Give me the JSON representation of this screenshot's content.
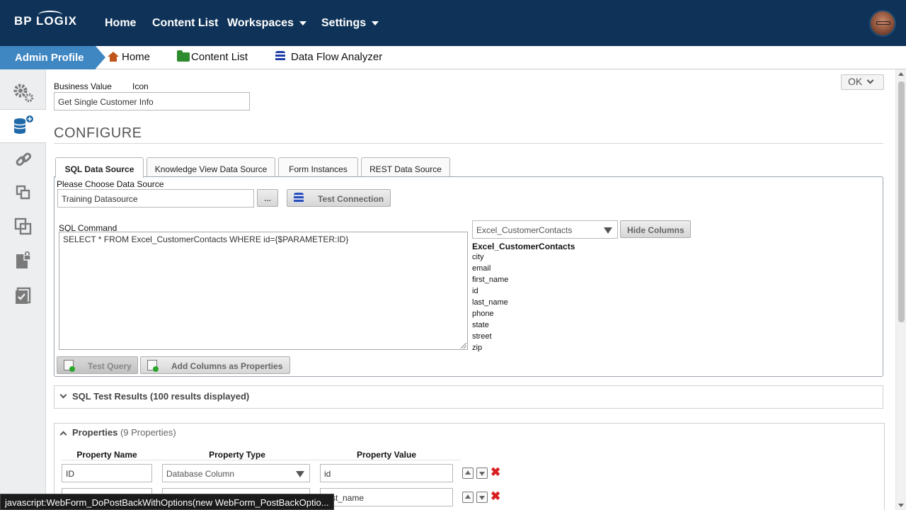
{
  "topnav": {
    "logo": "BP LOGIX",
    "items": [
      {
        "label": "Home"
      },
      {
        "label": "Content List"
      },
      {
        "label": "Workspaces"
      },
      {
        "label": "Settings"
      }
    ]
  },
  "breadcrumb": {
    "current": "Admin Profile",
    "links": [
      {
        "label": "Home",
        "icon": "home-icon"
      },
      {
        "label": "Content List",
        "icon": "folder-icon"
      },
      {
        "label": "Data Flow Analyzer",
        "icon": "database-icon"
      }
    ]
  },
  "sidebar": {
    "items": [
      {
        "icon": "gears-icon"
      },
      {
        "icon": "database-add-icon",
        "active": true
      },
      {
        "icon": "link-icon"
      },
      {
        "icon": "windows-icon"
      },
      {
        "icon": "copy-icon"
      },
      {
        "icon": "lock-document-icon"
      },
      {
        "icon": "checklist-icon"
      }
    ]
  },
  "form": {
    "business_value_label": "Business Value",
    "icon_label": "Icon",
    "business_value": "Get Single Customer Info",
    "ok_label": "OK",
    "section_title": "CONFIGURE"
  },
  "tabs": [
    {
      "label": "SQL Data Source",
      "active": true
    },
    {
      "label": "Knowledge View Data Source"
    },
    {
      "label": "Form Instances"
    },
    {
      "label": "REST Data Source"
    }
  ],
  "sql": {
    "choose_label": "Please Choose Data Source",
    "data_source": "Training Datasource",
    "browse_label": "...",
    "test_connection_label": "Test Connection",
    "command_label": "SQL Command",
    "command": "SELECT * FROM Excel_CustomerContacts WHERE id={$PARAMETER:ID}",
    "test_query_label": "Test Query",
    "add_columns_label": "Add Columns as Properties",
    "table_select": "Excel_CustomerContacts",
    "hide_columns_label": "Hide Columns",
    "table_name": "Excel_CustomerContacts",
    "columns": [
      "city",
      "email",
      "first_name",
      "id",
      "last_name",
      "phone",
      "state",
      "street",
      "zip"
    ]
  },
  "results": {
    "title": "SQL Test Results (100 results displayed)"
  },
  "properties": {
    "title": "Properties",
    "count": "(9 Properties)",
    "headers": [
      "Property Name",
      "Property Type",
      "Property Value"
    ],
    "rows": [
      {
        "name": "ID",
        "type": "Database Column",
        "value": "id"
      },
      {
        "name": "",
        "type": "",
        "value": "first_name"
      }
    ]
  },
  "status": {
    "text": "javascript:WebForm_DoPostBackWithOptions(new WebForm_PostBackOptio..."
  },
  "colors": {
    "nav_bg": "#0f3358",
    "crumb_active": "#3f87c3",
    "accent": "#1f6aa8",
    "delete": "#d81e1e"
  }
}
